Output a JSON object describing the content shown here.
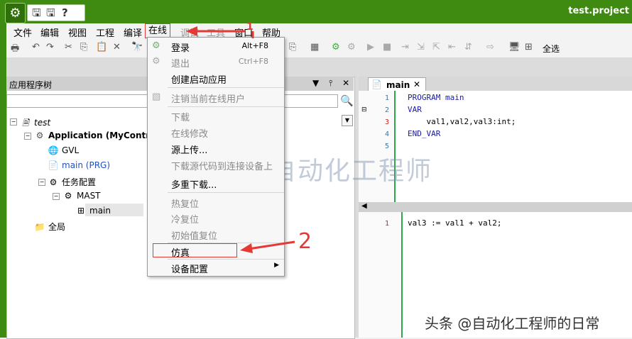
{
  "window": {
    "title": "test.project"
  },
  "menubar": [
    "文件",
    "编辑",
    "视图",
    "工程",
    "编译",
    "在线",
    "调试",
    "工具",
    "窗口",
    "帮助"
  ],
  "toolbar": {
    "select_all": "全选"
  },
  "tree_panel": {
    "title": "应用程序树",
    "nodes": [
      {
        "label": "test"
      },
      {
        "label": "Application (MyControlle"
      },
      {
        "label": "GVL"
      },
      {
        "label": "main (PRG)"
      },
      {
        "label": "任务配置"
      },
      {
        "label": "MAST"
      },
      {
        "label": "main"
      },
      {
        "label": "全局"
      }
    ]
  },
  "editor": {
    "tab_label": "main",
    "top_lines": [
      {
        "n": "1",
        "text": "PROGRAM main"
      },
      {
        "n": "2",
        "text": "VAR"
      },
      {
        "n": "3",
        "text": "    val1,val2,val3:int;"
      },
      {
        "n": "4",
        "text": "END_VAR"
      },
      {
        "n": "5",
        "text": ""
      }
    ],
    "bottom_lines": [
      {
        "n": "1",
        "text": "val3 := val1 + val2;"
      }
    ]
  },
  "dropdown": {
    "items": [
      {
        "label": "登录",
        "shortcut": "Alt+F8"
      },
      {
        "label": "退出",
        "shortcut": "Ctrl+F8"
      },
      {
        "label": "创建启动应用",
        "shortcut": ""
      },
      {
        "label": "注销当前在线用户",
        "shortcut": ""
      },
      {
        "label": "下载",
        "shortcut": ""
      },
      {
        "label": "在线修改",
        "shortcut": ""
      },
      {
        "label": "源上传...",
        "shortcut": ""
      },
      {
        "label": "下载源代码到连接设备上",
        "shortcut": ""
      },
      {
        "label": "多重下载...",
        "shortcut": ""
      },
      {
        "label": "热复位",
        "shortcut": ""
      },
      {
        "label": "冷复位",
        "shortcut": ""
      },
      {
        "label": "初始值复位",
        "shortcut": ""
      },
      {
        "label": "仿真",
        "shortcut": ""
      },
      {
        "label": "设备配置",
        "shortcut": ""
      }
    ]
  },
  "annotations": {
    "step1": "1",
    "step2": "2"
  },
  "watermark": {
    "text": "图控自动化工程师",
    "footer": "头条 @自动化工程师的日常"
  },
  "colors": {
    "title_bar": "#3f8a10",
    "annotation_red": "#e53935",
    "line_number_blue": "#2b7bb9",
    "gutter_green": "#2aa84a"
  }
}
